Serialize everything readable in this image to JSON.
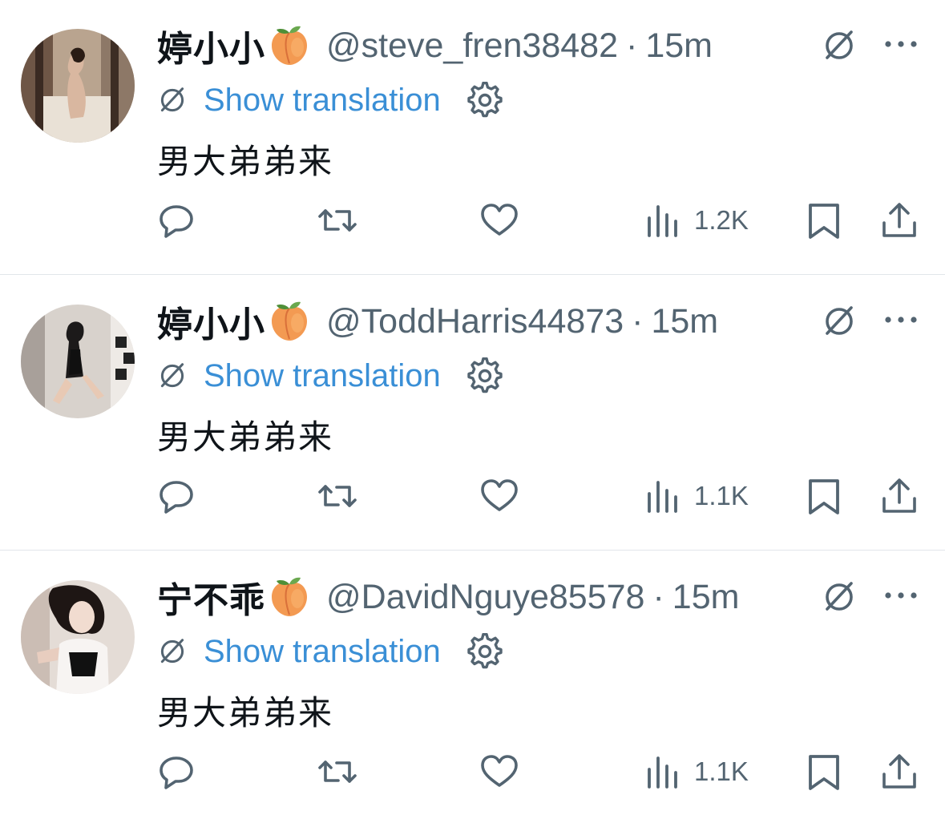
{
  "colors": {
    "text": "#0f1419",
    "muted": "#536471",
    "link": "#3a8fd6",
    "divider": "#e1e6ea"
  },
  "tweets": [
    {
      "display_name": "婷小小",
      "name_emoji": "peach-emoji",
      "handle": "@steve_fren38482",
      "separator": "·",
      "time": "15m",
      "translation_label": "Show translation",
      "text": "男大弟弟来",
      "views": "1.2K"
    },
    {
      "display_name": "婷小小",
      "name_emoji": "peach-emoji",
      "handle": "@ToddHarris44873",
      "separator": "·",
      "time": "15m",
      "translation_label": "Show translation",
      "text": "男大弟弟来",
      "views": "1.1K"
    },
    {
      "display_name": "宁不乖",
      "name_emoji": "peach-emoji",
      "handle": "@DavidNguye85578",
      "separator": "·",
      "time": "15m",
      "translation_label": "Show translation",
      "text": "男大弟弟来",
      "views": "1.1K"
    }
  ],
  "icons": {
    "translate": "translate-icon",
    "more": "more-icon",
    "settings": "gear-icon",
    "reply": "reply-icon",
    "retweet": "retweet-icon",
    "like": "heart-icon",
    "views": "views-icon",
    "bookmark": "bookmark-icon",
    "share": "share-icon"
  }
}
